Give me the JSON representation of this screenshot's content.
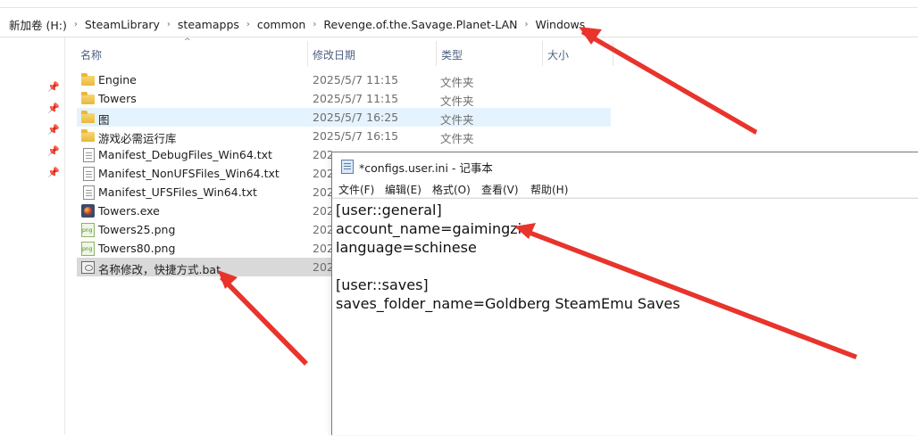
{
  "breadcrumb": [
    "新加卷 (H:)",
    "SteamLibrary",
    "steamapps",
    "common",
    "Revenge.of.the.Savage.Planet-LAN",
    "Windows"
  ],
  "columns": {
    "name": "名称",
    "date": "修改日期",
    "type": "类型",
    "size": "大小"
  },
  "files": [
    {
      "name": "Engine",
      "date": "2025/5/7 11:15",
      "type": "文件夹",
      "icon": "folder-icon"
    },
    {
      "name": "Towers",
      "date": "2025/5/7 11:15",
      "type": "文件夹",
      "icon": "folder-icon"
    },
    {
      "name": "图",
      "date": "2025/5/7 16:25",
      "type": "文件夹",
      "icon": "folder-icon"
    },
    {
      "name": "游戏必需运行库",
      "date": "2025/5/7 16:15",
      "type": "文件夹",
      "icon": "folder-icon"
    },
    {
      "name": "Manifest_DebugFiles_Win64.txt",
      "date": "202",
      "type": "",
      "icon": "text-file-icon"
    },
    {
      "name": "Manifest_NonUFSFiles_Win64.txt",
      "date": "202",
      "type": "",
      "icon": "text-file-icon"
    },
    {
      "name": "Manifest_UFSFiles_Win64.txt",
      "date": "202",
      "type": "",
      "icon": "text-file-icon"
    },
    {
      "name": "Towers.exe",
      "date": "202",
      "type": "",
      "icon": "exe-icon"
    },
    {
      "name": "Towers25.png",
      "date": "202",
      "type": "",
      "icon": "png-file-icon"
    },
    {
      "name": "Towers80.png",
      "date": "202",
      "type": "",
      "icon": "png-file-icon"
    },
    {
      "name": "名称修改，快捷方式.bat",
      "date": "202",
      "type": "",
      "icon": "batch-file-icon"
    }
  ],
  "notepad": {
    "title": "*configs.user.ini - 记事本",
    "menu": [
      "文件(F)",
      "编辑(E)",
      "格式(O)",
      "查看(V)",
      "帮助(H)"
    ],
    "lines": [
      "[user::general]",
      "account_name=gaimingzi",
      "language=schinese",
      "",
      "[user::saves]",
      "saves_folder_name=Goldberg SteamEmu Saves"
    ]
  },
  "colors": {
    "selection": "#cce8ff",
    "focus_row": "#d9d9d9",
    "arrow": "#e8342c",
    "header_text": "#4d6082"
  }
}
